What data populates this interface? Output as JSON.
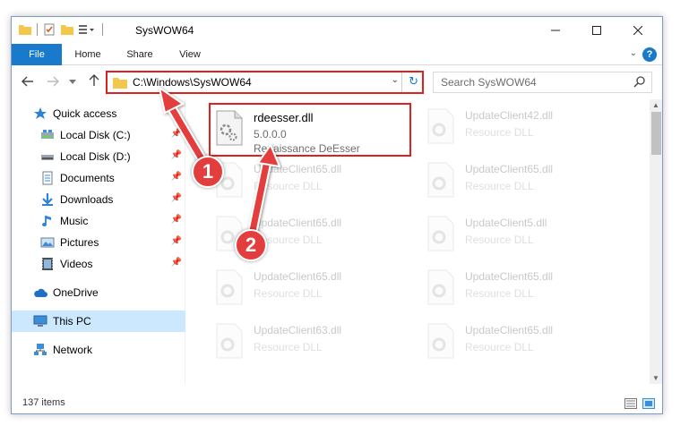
{
  "window": {
    "title": "SysWOW64"
  },
  "ribbon": {
    "tabs": [
      "File",
      "Home",
      "Share",
      "View"
    ]
  },
  "address": {
    "path": "C:\\Windows\\SysWOW64",
    "search_placeholder": "Search SysWOW64"
  },
  "sidebar": {
    "items": [
      {
        "label": "Quick access",
        "icon": "star-icon",
        "pinned": false
      },
      {
        "label": "Local Disk (C:)",
        "icon": "drive-icon",
        "pinned": true
      },
      {
        "label": "Local Disk (D:)",
        "icon": "drive-icon",
        "pinned": true
      },
      {
        "label": "Documents",
        "icon": "documents-icon",
        "pinned": true
      },
      {
        "label": "Downloads",
        "icon": "downloads-icon",
        "pinned": true
      },
      {
        "label": "Music",
        "icon": "music-icon",
        "pinned": true
      },
      {
        "label": "Pictures",
        "icon": "pictures-icon",
        "pinned": true
      },
      {
        "label": "Videos",
        "icon": "videos-icon",
        "pinned": true
      },
      {
        "label": "OneDrive",
        "icon": "cloud-icon",
        "pinned": false
      },
      {
        "label": "This PC",
        "icon": "computer-icon",
        "pinned": false
      },
      {
        "label": "Network",
        "icon": "network-icon",
        "pinned": false
      }
    ]
  },
  "files": [
    {
      "name": "rdeesser.dll",
      "version": "5.0.0.0",
      "desc": "Renaissance DeEsser"
    },
    {
      "name": "UpdateClient42.dll",
      "desc": "Resource DLL"
    },
    {
      "name": "UpdateClient65.dll",
      "desc": "Resource DLL"
    },
    {
      "name": "UpdateClient65.dll",
      "desc": "Resource DLL"
    },
    {
      "name": "UpdateClient65.dll",
      "desc": "Resource DLL"
    },
    {
      "name": "UpdateClient5.dll",
      "desc": "Resource DLL"
    },
    {
      "name": "UpdateClient65.dll",
      "desc": "Resource DLL"
    },
    {
      "name": "UpdateClient65.dll",
      "desc": "Resource DLL"
    },
    {
      "name": "UpdateClient63.dll",
      "desc": "Resource DLL"
    },
    {
      "name": "UpdateClient65.dll",
      "desc": "Resource DLL"
    }
  ],
  "status": {
    "items": "137 items"
  },
  "annotations": {
    "step1": "1",
    "step2": "2"
  },
  "colors": {
    "accent": "#1979ca",
    "highlight": "#e02020",
    "selected": "#cce8ff"
  }
}
